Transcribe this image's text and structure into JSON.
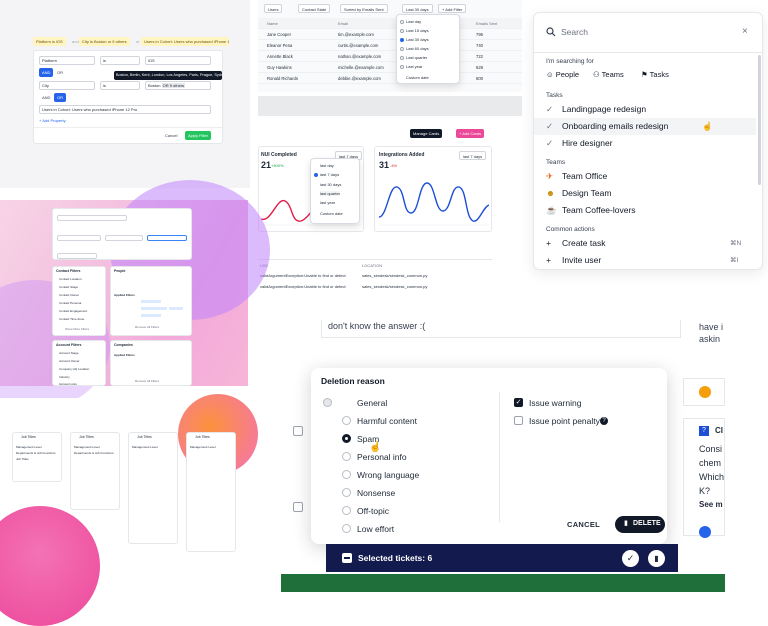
{
  "panel_a": {
    "filter_chips": [
      "Platform is iOS",
      "and",
      "City is Boston or 9 others",
      "or",
      "Users in Cohort: Users who purchased iPhone 12 Pro"
    ],
    "rows": [
      {
        "field": "Platform",
        "op": "is",
        "value": "iOS"
      },
      {
        "field": "City",
        "op": "is",
        "value": "Boston",
        "extra": "OR  9 others"
      }
    ],
    "and_label": "AND",
    "or_label": "OR",
    "tooltip": "Boston, Berlin, Kent, London, Los Angeles, Paris, Prague, Sydney, Tokyo",
    "cohort_value": "Users in Cohort: Users who purchased iPhone 12 Pro",
    "add_property": "+ Add Property",
    "cancel": "Cancel",
    "apply": "Apply Filter"
  },
  "panel_b": {
    "toolbar": [
      "Users",
      "Contact State",
      "Sorted by Emails Sent",
      "Last 30 days",
      "+ Add Filter"
    ],
    "columns": [
      "Name",
      "Email",
      "Emails Sent"
    ],
    "rows": [
      {
        "name": "Jane Cooper",
        "email": "tim.@example.com",
        "sent": "796"
      },
      {
        "name": "Eleanor Pena",
        "email": "curtis.@example.com",
        "sent": "740"
      },
      {
        "name": "Annette Black",
        "email": "nathan.@example.com",
        "sent": "722"
      },
      {
        "name": "Guy Hawkins",
        "email": "michelle.@example.com",
        "sent": "628"
      },
      {
        "name": "Ronald Richards",
        "email": "debbie.@example.com",
        "sent": "600"
      }
    ],
    "date_options": [
      "Last day",
      "Last 15 days",
      "Last 30 days",
      "Last 60 days",
      "Last quarter",
      "Last year",
      "Custom date"
    ],
    "selected_option": "Last 30 days"
  },
  "panel_c": {
    "manage_cards": "Manage Cards",
    "add_cards": "+ Add Cards",
    "card1": {
      "title": "NUI Completed",
      "value": "21",
      "delta": "+400%",
      "range": "last 7 days"
    },
    "card2": {
      "title": "Integrations Added",
      "value": "31",
      "delta": "-4%",
      "range": "last 7 days"
    },
    "range_options": [
      "last day",
      "last 7 days",
      "last 30 days",
      "last quarter",
      "last year",
      "Custom date"
    ],
    "table_headers": [
      "USE",
      "LOCATION"
    ],
    "table_rows": [
      {
        "error": "validArgumentException:Unable to find or detect",
        "location": "sales_sendesk/sendesk_common.py"
      },
      {
        "error": "validArgumentException:Unable to find or detect",
        "location": "sales_sendesk/sendesk_common.py"
      }
    ]
  },
  "palette": {
    "search_placeholder": "Search",
    "searching_for": "I'm searching for",
    "chips": [
      "People",
      "Teams",
      "Tasks"
    ],
    "tasks_header": "Tasks",
    "tasks": [
      "Landingpage redesign",
      "Onboarding emails redesign",
      "Hire designer"
    ],
    "teams_header": "Teams",
    "teams": [
      "Team Office",
      "Design Team",
      "Team Coffee-lovers"
    ],
    "actions_header": "Common actions",
    "actions": [
      {
        "label": "Create task",
        "shortcut": "⌘N"
      },
      {
        "label": "Invite user",
        "shortcut": "⌘I"
      }
    ]
  },
  "panel_e": {
    "labels": [
      "Contact Filters",
      "Account Filters",
      "People",
      "Companies",
      "Applied Filters"
    ],
    "contact_items": [
      "Contact Location",
      "Contact Stage",
      "Contact Owner",
      "Contact Persona",
      "Contact Engagement",
      "Contact Time Zone"
    ],
    "account_items": [
      "Account Stage",
      "Account Owner",
      "Company HQ Location",
      "Industry",
      "Account Lists"
    ],
    "remove_all": "Remove All Filters",
    "show_more": "Show More Filters"
  },
  "panel_f": {
    "titles": [
      "Job Titles",
      "Job Titles",
      "Job Titles",
      "Job Titles"
    ],
    "groups": [
      "Management Level",
      "Departments & Job Functions",
      "Job Titles"
    ]
  },
  "deletion": {
    "partial_top": "don't know the answer :(",
    "right_partial": [
      "have i",
      "askin"
    ],
    "title": "Deletion reason",
    "reasons": [
      "General",
      "Harmful content",
      "Spam",
      "Personal info",
      "Wrong language",
      "Nonsense",
      "Off-topic",
      "Low effort"
    ],
    "selected": "Spam",
    "issue_warning": "Issue warning",
    "issue_penalty": "Issue point penalty",
    "cancel": "CANCEL",
    "delete": "DELETE",
    "selected_bar": "Selected tickets: 6",
    "side_partial": [
      "CI",
      "Consi",
      "chem",
      "Which",
      "K?",
      "See m"
    ]
  },
  "colors": {
    "accent_green": "#22c55e",
    "brand_pink": "#ec4899",
    "navy": "#131a4d",
    "dark_green": "#1f6f3a"
  }
}
